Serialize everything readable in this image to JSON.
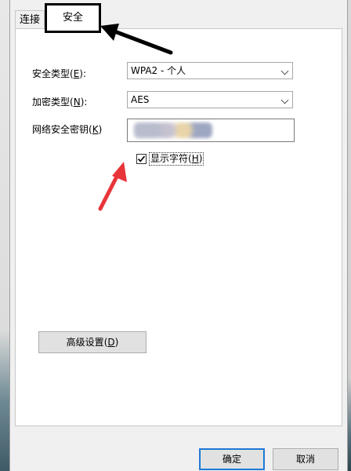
{
  "tabs": [
    {
      "label": "连接"
    },
    {
      "label": "安全"
    }
  ],
  "security_type": {
    "label": "安全类型",
    "key": "E",
    "value": "WPA2 - 个人"
  },
  "encryption_type": {
    "label": "加密类型",
    "key": "N",
    "value": "AES"
  },
  "network_key": {
    "label": "网络安全密钥",
    "key": "K"
  },
  "show_chars": {
    "label": "显示字符",
    "key": "H",
    "checked": true
  },
  "advanced_button": {
    "label": "高级设置",
    "key": "D"
  },
  "footer": {
    "ok_label": "确定",
    "cancel_label": "取消"
  },
  "colors": {
    "accent": "#0078d7",
    "highlight_box": "#000000",
    "red_arrow": "#e8353a"
  }
}
